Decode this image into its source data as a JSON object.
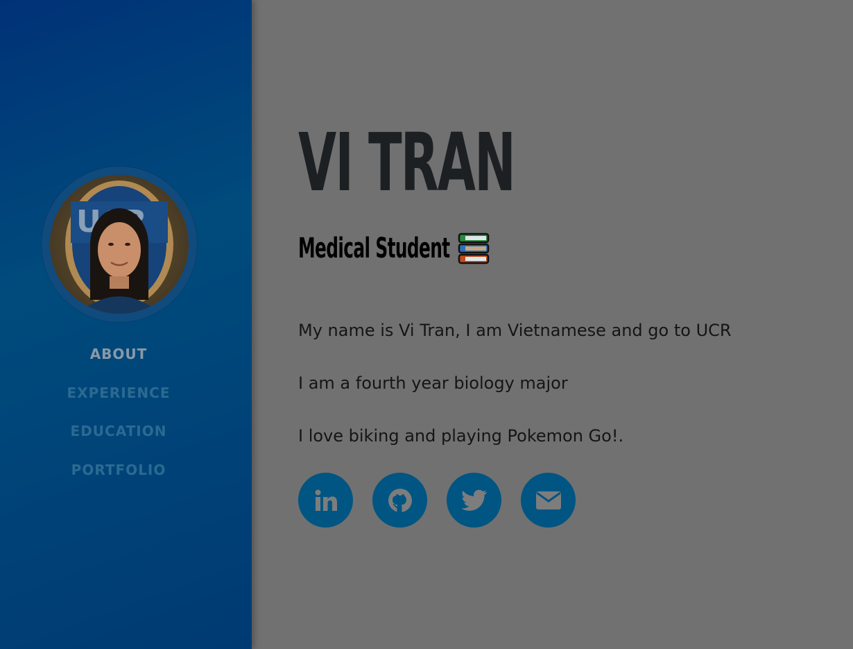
{
  "sidebar": {
    "avatar_alt": "Vi Tran profile photo",
    "nav": [
      {
        "label": "ABOUT",
        "active": true
      },
      {
        "label": "EXPERIENCE",
        "active": false
      },
      {
        "label": "EDUCATION",
        "active": false
      },
      {
        "label": "PORTFOLIO",
        "active": false
      }
    ]
  },
  "main": {
    "name": "VI TRAN",
    "subtitle": "Medical Student",
    "subtitle_icon": "books-icon",
    "bio": [
      "My name is Vi Tran, I am Vietnamese and go to UCR",
      "I am a fourth year biology major",
      "I love biking and playing Pokemon Go!."
    ],
    "social": [
      {
        "name": "linkedin-icon"
      },
      {
        "name": "github-icon"
      },
      {
        "name": "twitter-icon"
      },
      {
        "name": "envelope-icon"
      }
    ]
  },
  "colors": {
    "sidebar_start": "#003277",
    "sidebar_mid": "#004b7c",
    "page_overlay": "#717171",
    "social_button": "#005582",
    "nav_active": "#8a99a8",
    "nav_inactive": "#2b6a92"
  }
}
